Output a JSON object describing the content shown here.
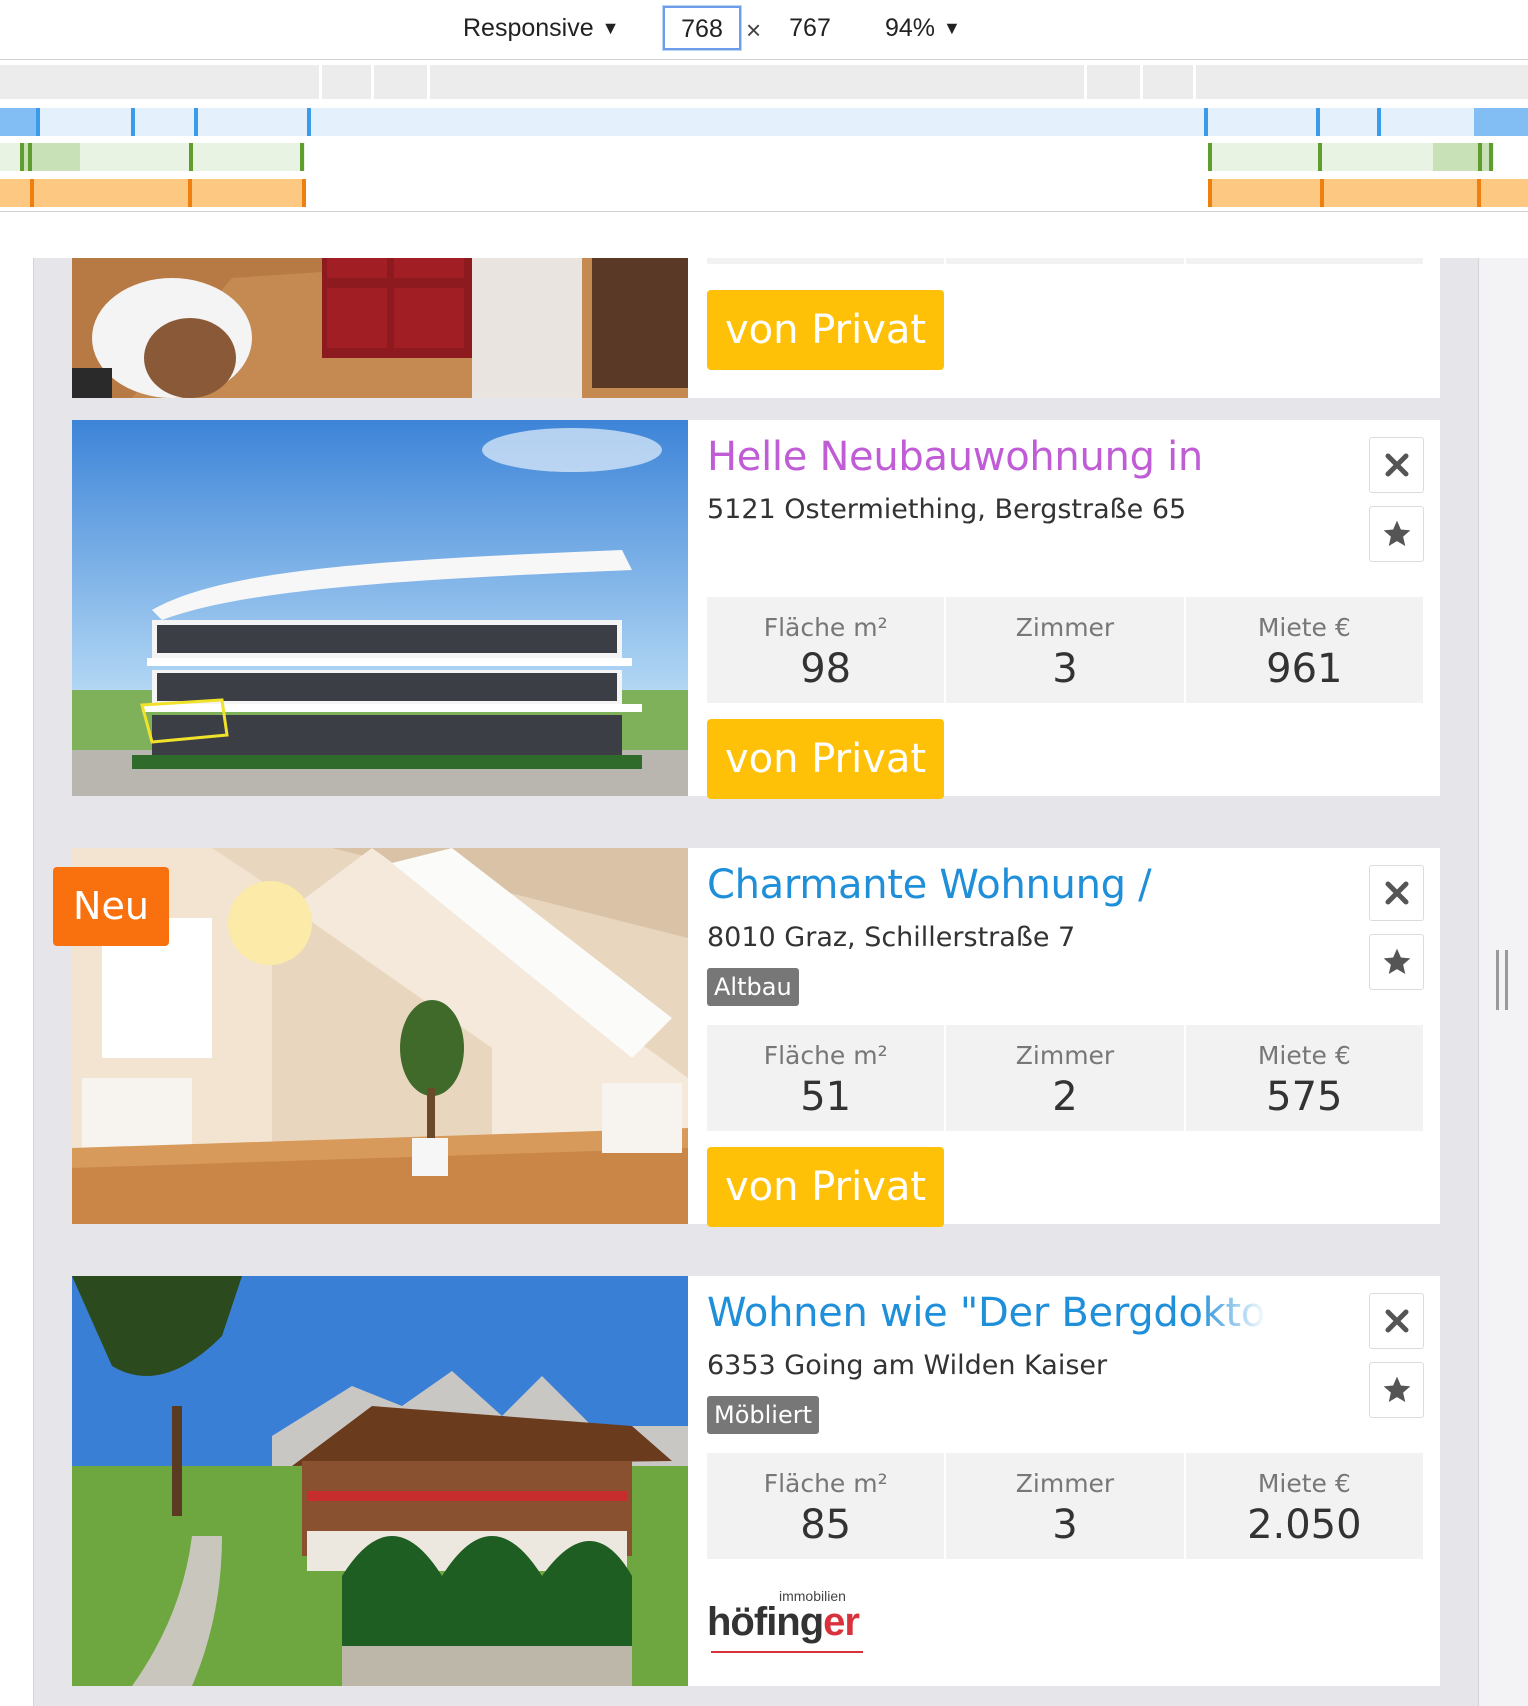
{
  "toolbar": {
    "device_label": "Responsive",
    "width_value": "768",
    "times": "×",
    "height_value": "767",
    "zoom_label": "94%",
    "dropdown_glyph": "▼"
  },
  "listings": [
    {
      "title": "",
      "address": "",
      "tag": "",
      "button_label": "von Privat"
    },
    {
      "title": "Helle Neubauwohnung in",
      "address": "5121 Ostermiething, Bergstraße 65",
      "stats": [
        {
          "label": "Fläche m²",
          "value": "98"
        },
        {
          "label": "Zimmer",
          "value": "3"
        },
        {
          "label": "Miete €",
          "value": "961"
        }
      ],
      "button_label": "von Privat"
    },
    {
      "badge": "Neu",
      "title": "Charmante Wohnung /",
      "address": "8010 Graz, Schillerstraße 7",
      "tag": "Altbau",
      "stats": [
        {
          "label": "Fläche m²",
          "value": "51"
        },
        {
          "label": "Zimmer",
          "value": "2"
        },
        {
          "label": "Miete €",
          "value": "575"
        }
      ],
      "button_label": "von Privat"
    },
    {
      "title": "Wohnen wie \"Der Bergdoktor",
      "address": "6353 Going am Wilden Kaiser",
      "tag": "Möbliert",
      "stats": [
        {
          "label": "Fläche m²",
          "value": "85"
        },
        {
          "label": "Zimmer",
          "value": "3"
        },
        {
          "label": "Miete €",
          "value": "2.050"
        }
      ],
      "agent_logo": {
        "top_text": "immobilien",
        "name_prefix": "höfing",
        "name_suffix": "er"
      }
    }
  ],
  "colors": {
    "accent_button": "#ffc107",
    "title_link": "#1f8fd9",
    "title_visited": "#c05cd6",
    "badge_new": "#f9710f",
    "tag_bg": "#777777"
  }
}
